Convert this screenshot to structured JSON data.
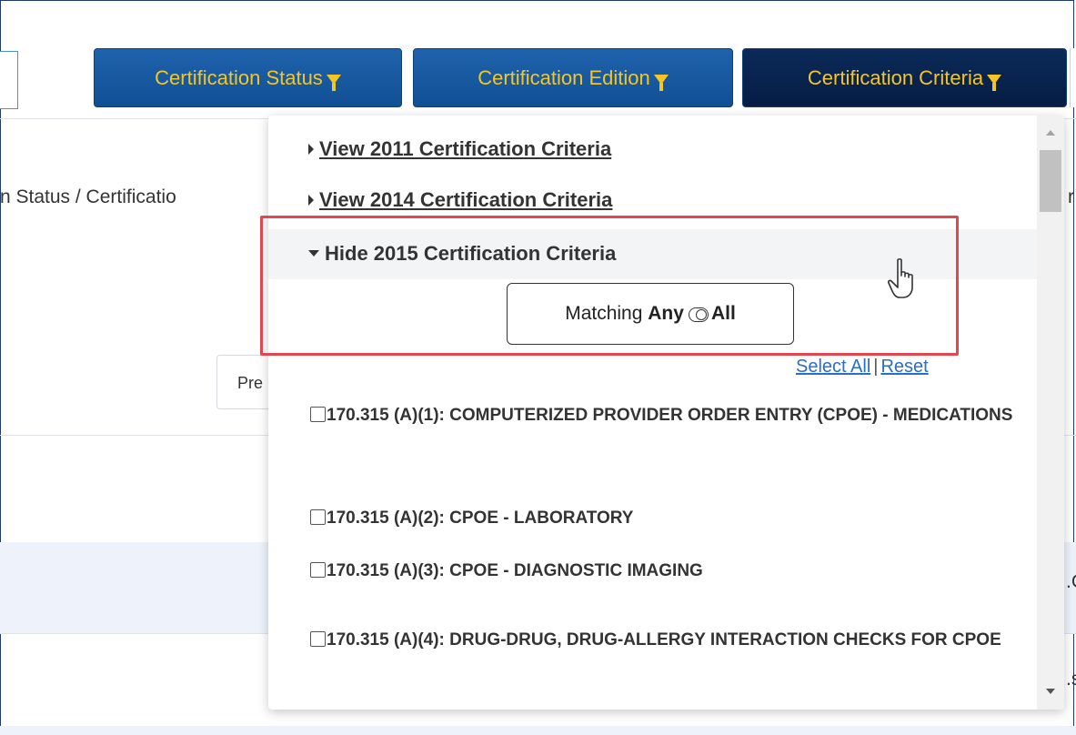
{
  "header": {
    "filters": [
      {
        "label": "Certification Status",
        "active": false
      },
      {
        "label": "Certification Edition",
        "active": false
      },
      {
        "label": "Certification Criteria",
        "active": true
      }
    ]
  },
  "background": {
    "breadcrumb_fragment": "n Status / Certificatio",
    "right_fragment": "r",
    "prev_fragment": "Pre",
    "row_fragment_1": ".C",
    "row_fragment_2": ".s"
  },
  "dropdown": {
    "groups": [
      {
        "label": "View 2011 Certification Criteria",
        "expanded": false
      },
      {
        "label": "View 2014 Certification Criteria",
        "expanded": false
      },
      {
        "label": "Hide 2015 Certification Criteria",
        "expanded": true
      }
    ],
    "matching": {
      "prefix": "Matching",
      "option_any": "Any",
      "option_all": "All"
    },
    "select_all": "Select All",
    "separator": "|",
    "reset": "Reset",
    "criteria": [
      {
        "label": "170.315 (A)(1): COMPUTERIZED PROVIDER ORDER ENTRY (CPOE) - MEDICATIONS",
        "checked": false
      },
      {
        "label": "170.315 (A)(2): CPOE - LABORATORY",
        "checked": false
      },
      {
        "label": "170.315 (A)(3): CPOE - DIAGNOSTIC IMAGING",
        "checked": false
      },
      {
        "label": "170.315 (A)(4): DRUG-DRUG, DRUG-ALLERGY INTERACTION CHECKS FOR CPOE",
        "checked": false
      }
    ]
  },
  "colors": {
    "button_bg": "#1f63ad",
    "button_active_bg": "#0b2a59",
    "button_text": "#f5c623",
    "link": "#2a6ec6",
    "highlight": "#e2474f"
  }
}
